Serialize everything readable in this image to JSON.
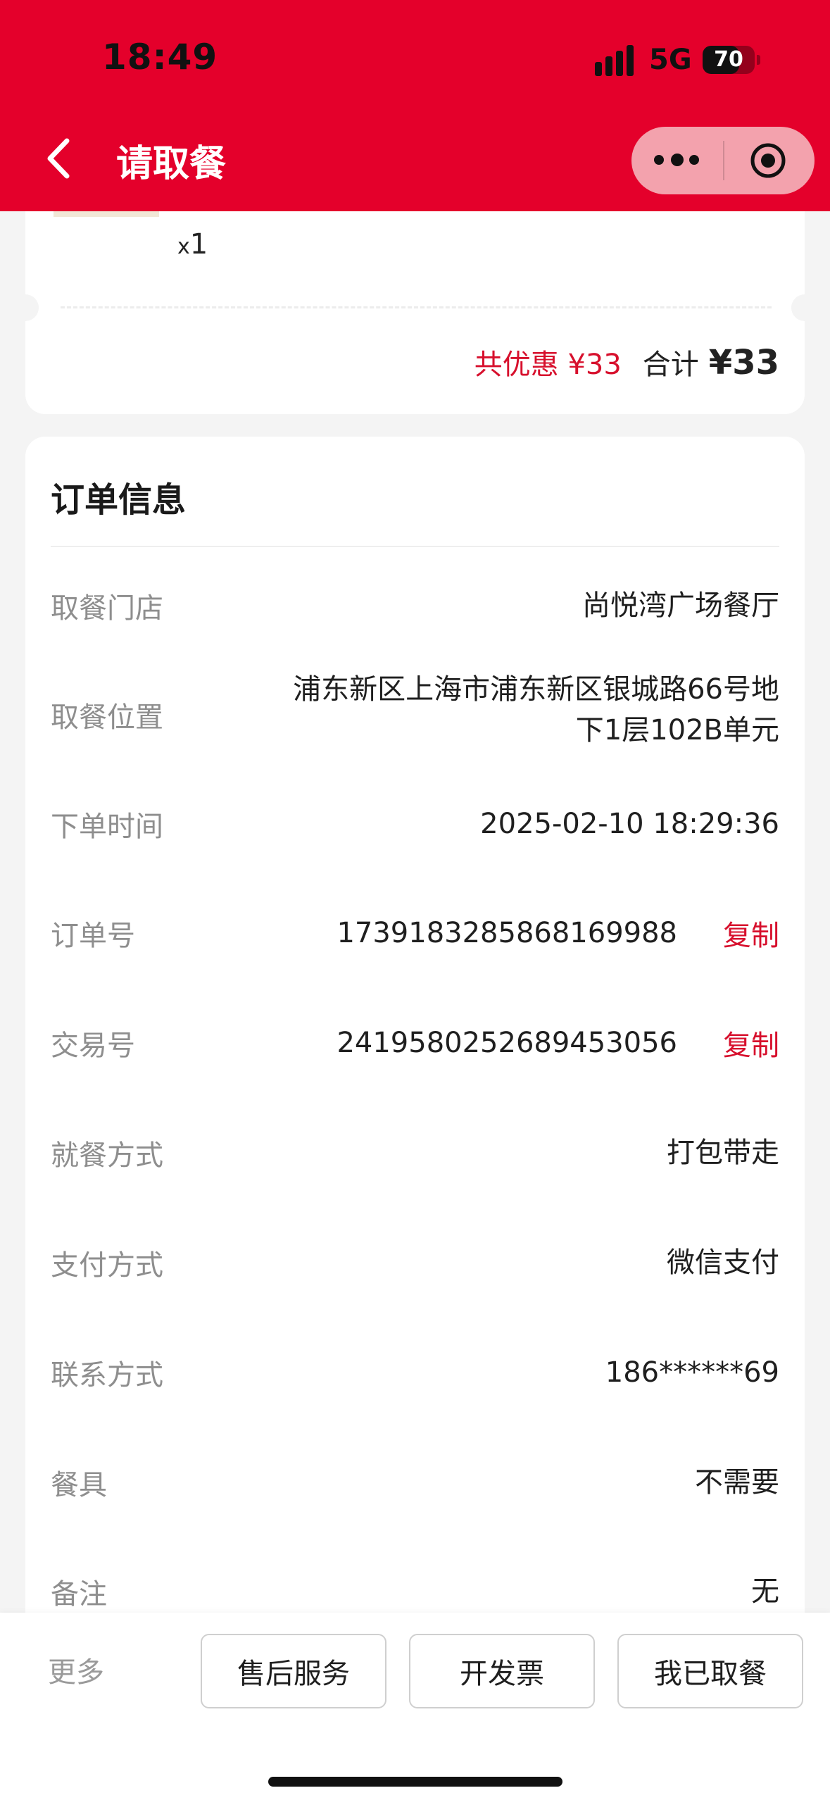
{
  "status_bar": {
    "time": "18:49",
    "network": "5G",
    "battery": "70"
  },
  "header": {
    "title": "请取餐",
    "background_color": "#e4002b"
  },
  "order_summary": {
    "quantity_prefix": "x",
    "quantity": "1",
    "discount_text": "共优惠 ¥33",
    "total_label": "合计",
    "total_value": "¥33"
  },
  "order_info": {
    "title": "订单信息",
    "rows": [
      {
        "label": "取餐门店",
        "value": "尚悦湾广场餐厅"
      },
      {
        "label": "取餐位置",
        "value_line1": "浦东新区上海市浦东新区银城路66号地",
        "value_line2": "下1层102B单元"
      },
      {
        "label": "下单时间",
        "value": "2025-02-10 18:29:36"
      },
      {
        "label": "订单号",
        "value": "1739183285868169988",
        "action": "复制"
      },
      {
        "label": "交易号",
        "value": "2419580252689453056",
        "action": "复制"
      },
      {
        "label": "就餐方式",
        "value": "打包带走"
      },
      {
        "label": "支付方式",
        "value": "微信支付"
      },
      {
        "label": "联系方式",
        "value": "186******69"
      },
      {
        "label": "餐具",
        "value": "不需要"
      },
      {
        "label": "备注",
        "value": "无"
      }
    ]
  },
  "bottom_bar": {
    "more": "更多",
    "buttons": [
      "售后服务",
      "开发票",
      "我已取餐"
    ]
  },
  "colors": {
    "accent_red": "#d7102d",
    "label_gray": "#8e8e8e"
  }
}
